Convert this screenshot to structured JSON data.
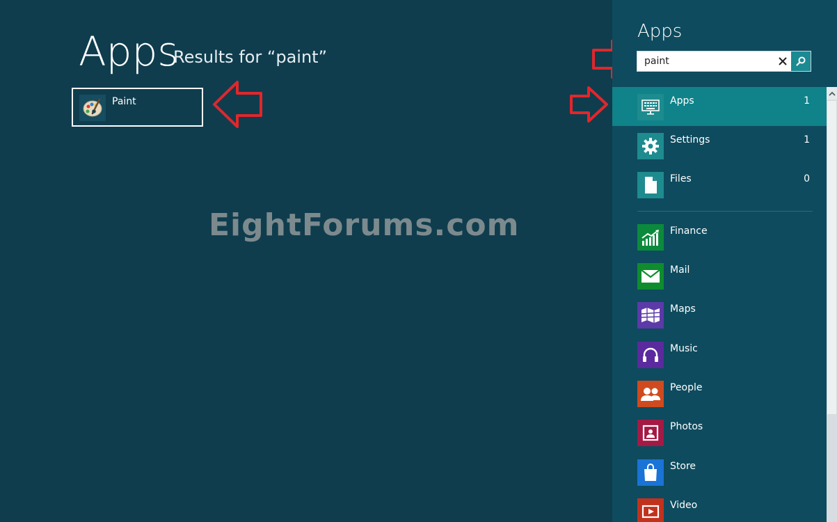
{
  "main": {
    "heading": "Apps",
    "results_for": "Results for “paint”",
    "results": [
      {
        "label": "Paint",
        "icon": "paint-palette-icon"
      }
    ]
  },
  "watermark": "EightForums.com",
  "charm": {
    "title": "Apps",
    "search": {
      "value": "paint",
      "clear_icon": "close-icon",
      "search_icon": "search-icon"
    },
    "scopes": [
      {
        "label": "Apps",
        "count": "1",
        "icon": "keyboard-icon",
        "selected": true
      },
      {
        "label": "Settings",
        "count": "1",
        "icon": "gear-icon",
        "selected": false
      },
      {
        "label": "Files",
        "count": "0",
        "icon": "file-icon",
        "selected": false
      }
    ],
    "apps": [
      {
        "label": "Finance",
        "icon": "finance-icon",
        "color": "#0b8a3c"
      },
      {
        "label": "Mail",
        "icon": "mail-icon",
        "color": "#0f8c2e"
      },
      {
        "label": "Maps",
        "icon": "maps-icon",
        "color": "#5c3aa8"
      },
      {
        "label": "Music",
        "icon": "headphones-icon",
        "color": "#5b2a9e"
      },
      {
        "label": "People",
        "icon": "people-icon",
        "color": "#d04a1f"
      },
      {
        "label": "Photos",
        "icon": "photos-icon",
        "color": "#a41a45"
      },
      {
        "label": "Store",
        "icon": "store-bag-icon",
        "color": "#1a73d6"
      },
      {
        "label": "Video",
        "icon": "video-icon",
        "color": "#c1321d"
      }
    ]
  },
  "colors": {
    "background": "#0f3d4e",
    "charm_background": "#0e4b5e",
    "selected_scope": "#0f8389",
    "annotation_arrow": "#e3262b"
  }
}
